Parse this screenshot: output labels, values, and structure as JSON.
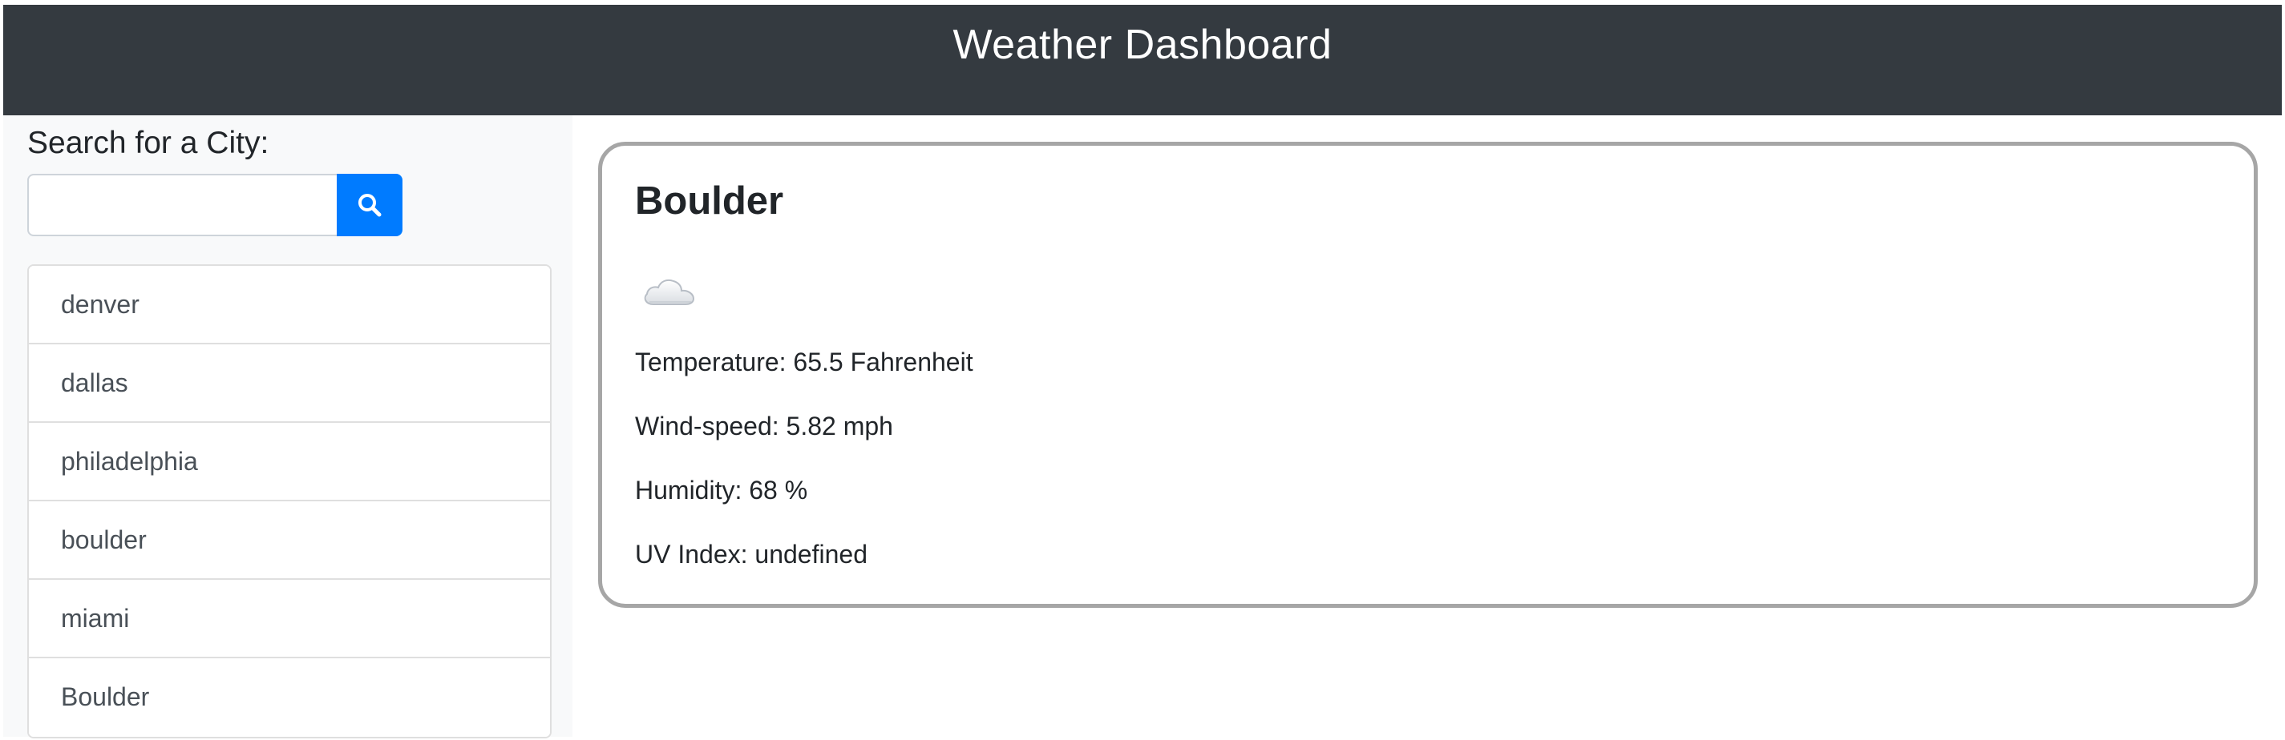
{
  "header": {
    "title": "Weather Dashboard"
  },
  "sidebar": {
    "search_label": "Search for a City:",
    "search_input_value": "",
    "search_input_placeholder": "",
    "search_button_icon": "search-icon",
    "cities": [
      {
        "name": "denver"
      },
      {
        "name": "dallas"
      },
      {
        "name": "philadelphia"
      },
      {
        "name": "boulder"
      },
      {
        "name": "miami"
      },
      {
        "name": "Boulder"
      }
    ]
  },
  "current": {
    "city": "Boulder",
    "icon": "cloud-icon",
    "temperature": "Temperature: 65.5 Fahrenheit",
    "wind_speed": "Wind-speed: 5.82 mph",
    "humidity": "Humidity: 68 %",
    "uv_index": "UV Index: undefined"
  },
  "colors": {
    "header_bg": "#343a40",
    "button_accent": "#007bff",
    "sidebar_bg": "#f8f9fa",
    "card_border": "#a6a6a6"
  }
}
